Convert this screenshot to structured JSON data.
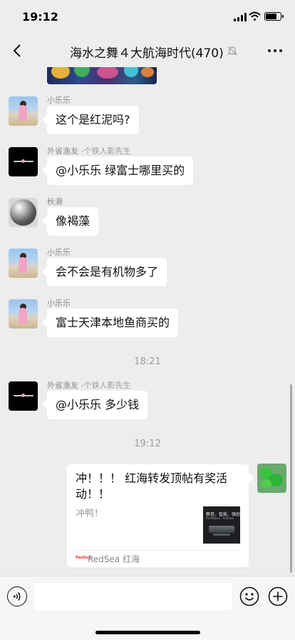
{
  "status_bar": {
    "time": "19:12"
  },
  "nav": {
    "title": "海水之舞４大航海时代(470)"
  },
  "messages": [
    {
      "sender": "小乐乐",
      "sender_tag": "",
      "text": "这个是红泥吗?"
    },
    {
      "sender": "外省渔友",
      "sender_tag": "-个铁人影先生",
      "text": "@小乐乐 绿富士哪里买的"
    },
    {
      "sender": "秋濑",
      "sender_tag": "",
      "text": "像褐藻"
    },
    {
      "sender": "小乐乐",
      "sender_tag": "",
      "text": "会不会是有机物多了"
    },
    {
      "sender": "小乐乐",
      "sender_tag": "",
      "text": "富士天津本地鱼商买的"
    },
    {
      "sender": "外省渔友",
      "sender_tag": "-个铁人影先生",
      "text": "@小乐乐 多少钱"
    }
  ],
  "time_labels": [
    "18:21",
    "19:12"
  ],
  "card": {
    "title": "冲！！！ 红海转发顶帖有奖活动！！",
    "description": "冲鸭！",
    "thumb_title": "静音、智能、强劲",
    "thumb_subtitle": "ReefWave · RedSea",
    "source_logo": "RedSea",
    "source": "RedSea 红海"
  },
  "icons": [
    "back-arrow-icon",
    "mute-bell-icon",
    "more-dots-icon",
    "voice-icon",
    "emoji-icon",
    "plus-icon"
  ]
}
